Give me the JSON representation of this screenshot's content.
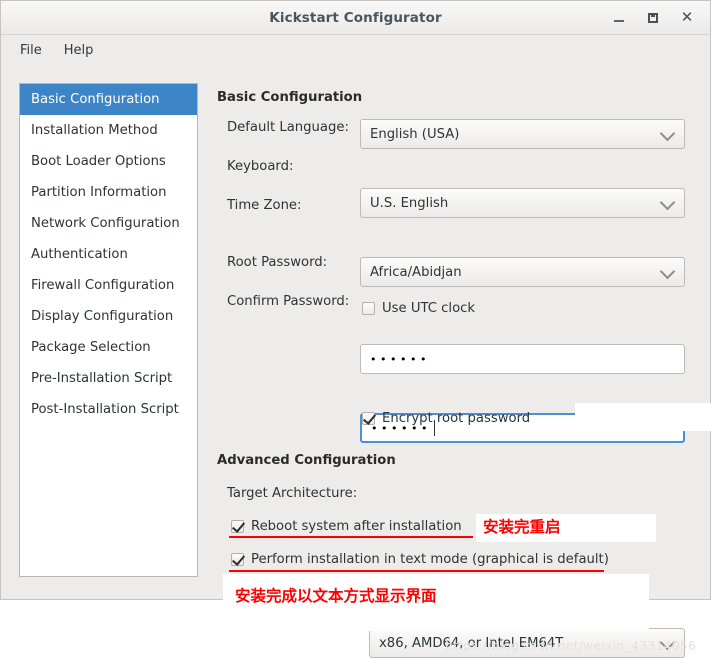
{
  "window": {
    "title": "Kickstart Configurator",
    "controls": {
      "minimize": "minimize-button",
      "maximize": "maximize-button",
      "close": "close-button"
    }
  },
  "menubar": {
    "items": [
      {
        "label": "File"
      },
      {
        "label": "Help"
      }
    ]
  },
  "sidebar": {
    "items": [
      {
        "label": "Basic Configuration",
        "selected": true
      },
      {
        "label": "Installation Method",
        "selected": false
      },
      {
        "label": "Boot Loader Options",
        "selected": false
      },
      {
        "label": "Partition Information",
        "selected": false
      },
      {
        "label": "Network Configuration",
        "selected": false
      },
      {
        "label": "Authentication",
        "selected": false
      },
      {
        "label": "Firewall Configuration",
        "selected": false
      },
      {
        "label": "Display Configuration",
        "selected": false
      },
      {
        "label": "Package Selection",
        "selected": false
      },
      {
        "label": "Pre-Installation Script",
        "selected": false
      },
      {
        "label": "Post-Installation Script",
        "selected": false
      }
    ]
  },
  "basic_configuration": {
    "heading": "Basic Configuration",
    "default_language": {
      "label": "Default Language:",
      "value": "English (USA)"
    },
    "keyboard": {
      "label": "Keyboard:",
      "value": "U.S. English"
    },
    "time_zone": {
      "label": "Time Zone:",
      "value": "Africa/Abidjan"
    },
    "use_utc_clock": {
      "label": "Use UTC clock",
      "checked": false
    },
    "root_password": {
      "label": "Root Password:",
      "value": "••••••"
    },
    "confirm_password": {
      "label": "Confirm Password:",
      "value": "••••••"
    },
    "encrypt_root_password": {
      "label": "Encrypt root password",
      "checked": true
    }
  },
  "advanced_configuration": {
    "heading": "Advanced Configuration",
    "target_architecture": {
      "label": "Target Architecture:",
      "value": "x86, AMD64, or Intel EM64T"
    },
    "reboot_after_install": {
      "label": "Reboot system after installation",
      "checked": true
    },
    "text_mode_install": {
      "label": "Perform installation in text mode (graphical is default)",
      "checked": true
    }
  },
  "annotations": {
    "note_reboot": "安装完重启",
    "note_textmode": "安装完成以文本方式显示界面",
    "color": "#ff0000"
  },
  "watermark": {
    "text": "https://blog.csdn.net/weixin_43314056"
  },
  "colors": {
    "accent": "#3d85c6",
    "focus": "#4a90d9",
    "window_bg": "#edecea",
    "annotation_red": "#ff0000"
  }
}
